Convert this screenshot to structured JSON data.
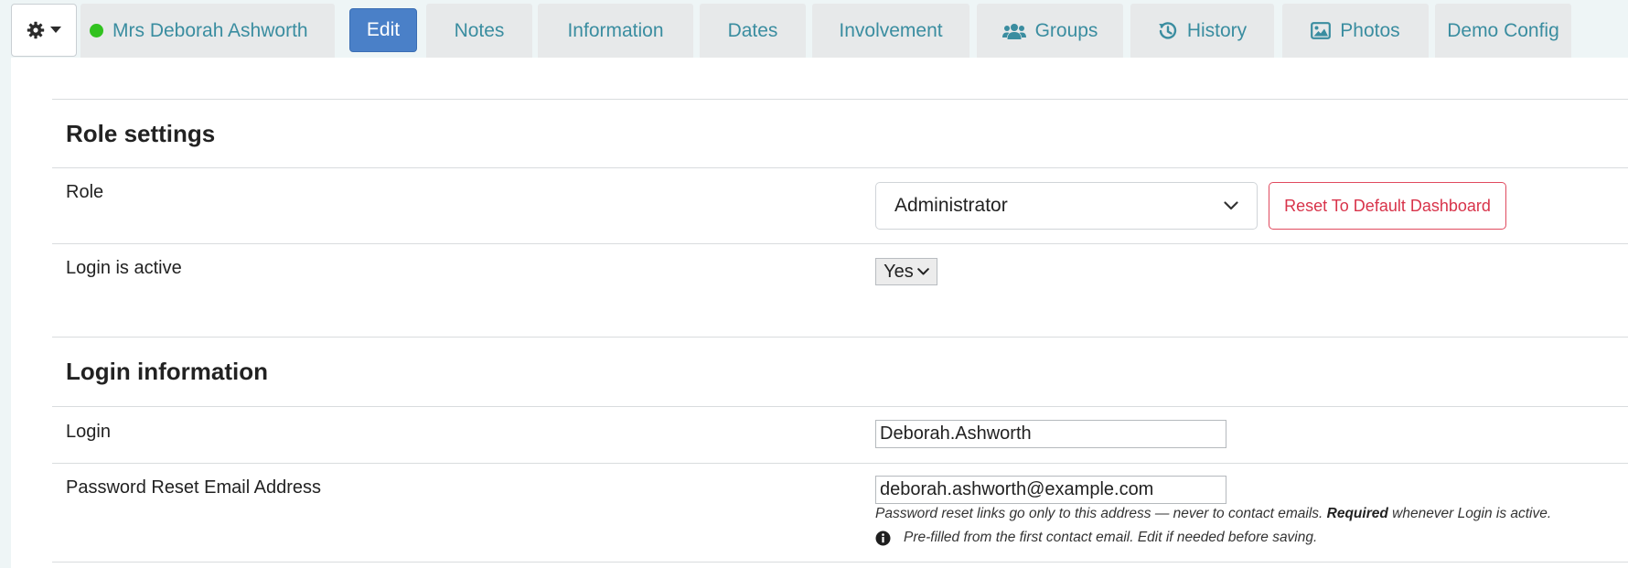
{
  "header": {
    "contact_name": "Mrs Deborah Ashworth",
    "tabs": [
      {
        "label": "Edit",
        "icon": null,
        "active": true
      },
      {
        "label": "Notes",
        "icon": null
      },
      {
        "label": "Information",
        "icon": null
      },
      {
        "label": "Dates",
        "icon": null
      },
      {
        "label": "Involvement",
        "icon": null
      },
      {
        "label": "Groups",
        "icon": "users-icon"
      },
      {
        "label": "History",
        "icon": "history-icon"
      },
      {
        "label": "Photos",
        "icon": "image-icon"
      },
      {
        "label": "Demo Config",
        "icon": null
      }
    ],
    "colors": {
      "active_tab": "#4a80c8",
      "tab_text": "#3a8da0",
      "status_online": "#31c21f"
    }
  },
  "role_settings": {
    "title": "Role settings",
    "role_label": "Role",
    "role_value": "Administrator",
    "reset_button": "Reset To Default Dashboard",
    "login_active_label": "Login is active",
    "login_active_value": "Yes"
  },
  "login_information": {
    "title": "Login information",
    "login_label": "Login",
    "login_value": "Deborah.Ashworth",
    "email_label": "Password Reset Email Address",
    "email_value": "deborah.ashworth@example.com",
    "help_part1": "Password reset links go only to this address — never to contact emails. ",
    "help_bold": "Required",
    "help_part2": " whenever Login is active.",
    "info_text": "Pre-filled from the first contact email. Edit if needed before saving."
  }
}
